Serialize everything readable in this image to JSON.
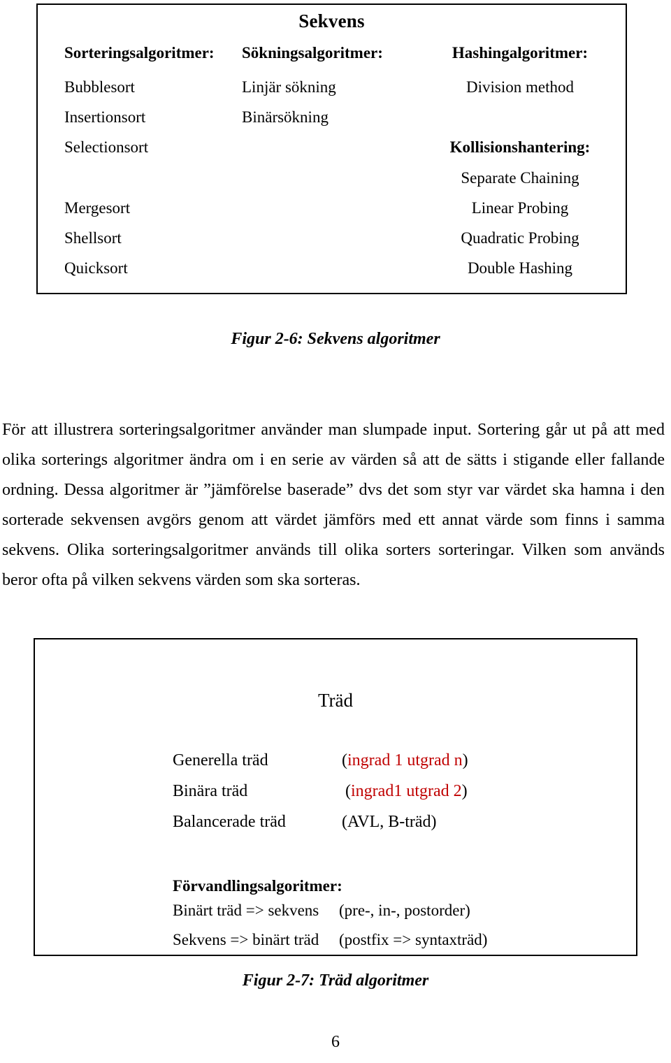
{
  "page": {
    "number": "6"
  },
  "figure_sekvens": {
    "title": "Sekvens",
    "columns": [
      {
        "id": "sorting",
        "header": "Sorteringsalgoritmer:",
        "items": [
          "Bubblesort",
          "Insertionsort",
          "Selectionsort",
          "Mergesort",
          "Shellsort",
          "Quicksort"
        ]
      },
      {
        "id": "searching",
        "header": "Sökningsalgoritmer:",
        "items": [
          "Linjär sökning",
          "Binärsökning"
        ]
      },
      {
        "id": "hashing",
        "header": "Hashingalgoritmer:",
        "items": [
          "Division method"
        ],
        "subheader": "Kollisionshantering:",
        "subitems": [
          "Separate Chaining",
          "Linear Probing",
          "Quadratic Probing",
          "Double Hashing"
        ]
      }
    ],
    "caption": "Figur 2-6: Sekvens algoritmer"
  },
  "body_paragraph": "För att illustrera sorteringsalgoritmer använder man slumpade input. Sortering går ut på att med olika sorterings algoritmer ändra om i en serie av värden så att de sätts i stigande eller fallande ordning. Dessa algoritmer är ”jämförelse baserade” dvs det som styr var värdet ska hamna i den sorterade sekvensen avgörs genom att värdet jämförs med ett annat värde som finns i samma sekvens. Olika sorteringsalgoritmer används till olika sorters sorteringar. Vilken som används beror ofta  på vilken sekvens värden som ska sorteras.",
  "figure_trad": {
    "title": "Träd",
    "rows": [
      {
        "name": "Generella träd",
        "open": "(",
        "value": "ingrad 1 utgrad n",
        "close": ")",
        "value_color": "#c00000"
      },
      {
        "name": "Binära träd",
        "open": "(",
        "value": "ingrad1 utgrad 2",
        "close": ")",
        "value_color": "#c00000"
      },
      {
        "name": "Balancerade träd",
        "open": "(",
        "value": "AVL, B-träd",
        "close": ")",
        "value_color": "#000000"
      }
    ],
    "transform_header": "Förvandlingsalgoritmer:",
    "transform_rows": [
      {
        "left": "Binärt träd => sekvens",
        "right": "(pre-, in-, postorder)"
      },
      {
        "left": "Sekvens => binärt träd",
        "right": "(postfix => syntaxträd)"
      }
    ],
    "caption": "Figur 2-7: Träd algoritmer"
  },
  "colors": {
    "text": "#000000",
    "accent_red": "#c00000",
    "border": "#000000",
    "background": "#ffffff"
  }
}
